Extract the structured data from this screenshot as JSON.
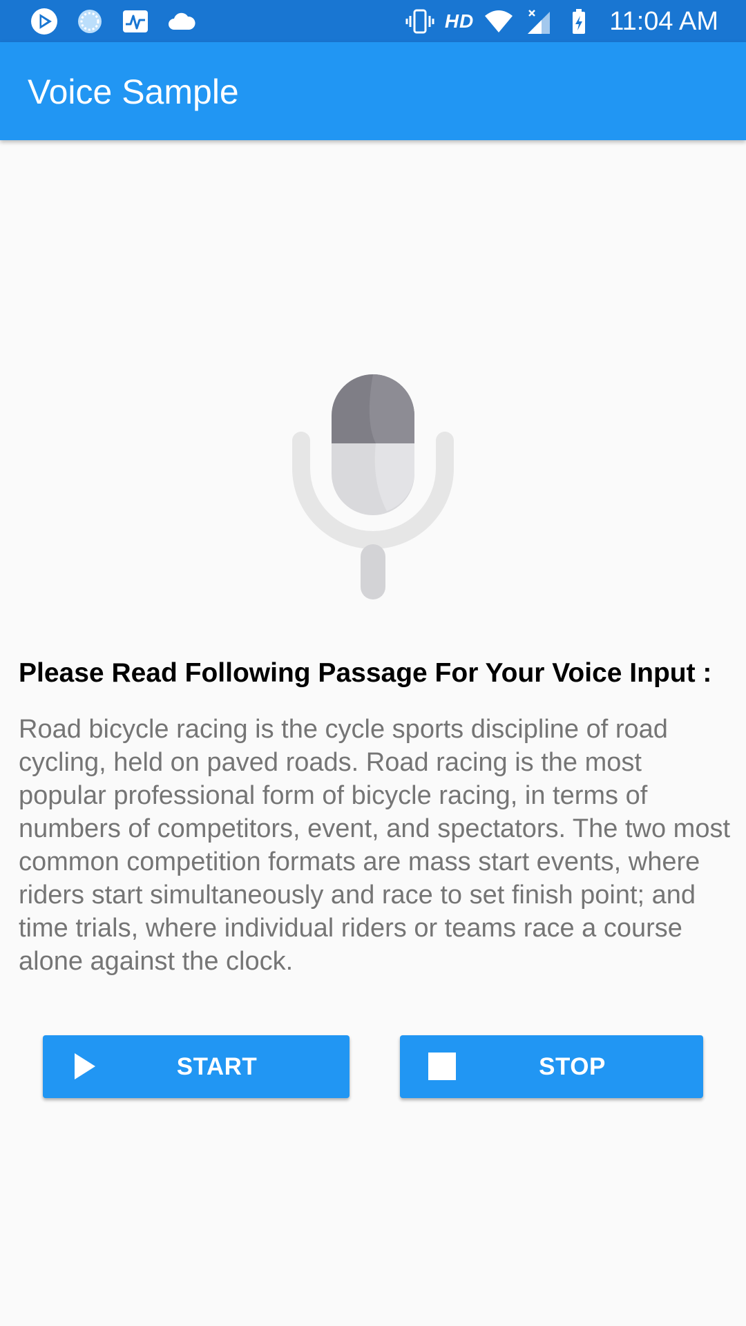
{
  "status_bar": {
    "time": "11:04 AM",
    "network_label": "HD",
    "icons": [
      "play-store-icon",
      "sync-icon",
      "activity-icon",
      "cloud-icon",
      "vibrate-icon",
      "wifi-icon",
      "signal-icon",
      "battery-charging-icon"
    ]
  },
  "app_bar": {
    "title": "Voice Sample"
  },
  "main": {
    "mic_icon": "microphone-icon",
    "heading": "Please Read Following Passage For Your Voice Input :",
    "passage": "Road bicycle racing is the cycle sports discipline of road cycling, held on paved roads. Road racing is the most popular professional form of bicycle racing, in terms of numbers of competitors, event, and spectators. The two most common competition formats are mass start events, where riders start simultaneously and race to set finish point; and time trials, where individual riders or teams race a course alone against the clock."
  },
  "buttons": {
    "start_label": "START",
    "start_icon": "play-icon",
    "stop_label": "STOP",
    "stop_icon": "stop-icon"
  },
  "colors": {
    "status_bar": "#1976d2",
    "app_bar": "#2196f3",
    "button": "#2196f3",
    "background": "#fafafa",
    "passage_text": "#757575"
  }
}
